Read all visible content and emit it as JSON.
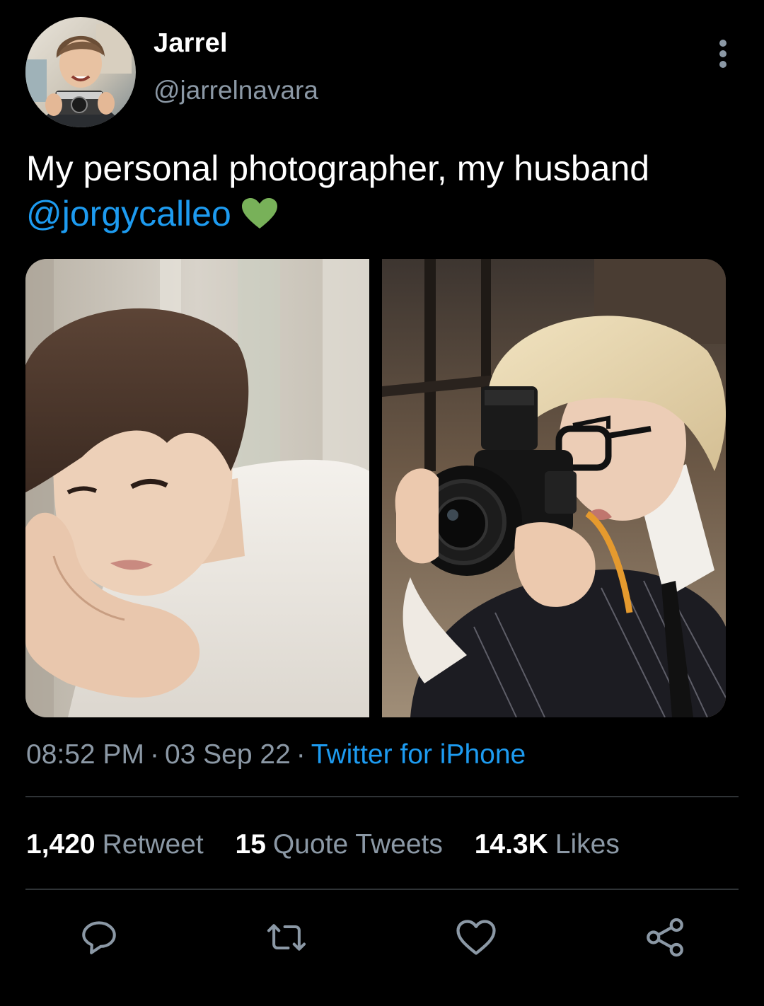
{
  "tweet": {
    "author": {
      "display_name": "Jarrel",
      "handle": "@jarrelnavara"
    },
    "text": {
      "line1": "My personal photographer, my husband",
      "mention": "@jorgycalleo",
      "emoji": "green-heart"
    },
    "media": [
      {
        "name": "photo-left"
      },
      {
        "name": "photo-right"
      }
    ],
    "timestamp": {
      "time": "08:52 PM",
      "date": "03 Sep 22",
      "separator": "·",
      "source": "Twitter for iPhone"
    },
    "stats": {
      "retweets": {
        "count": "1,420",
        "label": "Retweet"
      },
      "quotes": {
        "count": "15",
        "label": "Quote Tweets"
      },
      "likes": {
        "count": "14.3K",
        "label": "Likes"
      }
    },
    "actions": [
      {
        "icon": "reply-icon"
      },
      {
        "icon": "retweet-icon"
      },
      {
        "icon": "like-icon"
      },
      {
        "icon": "share-icon"
      }
    ]
  },
  "colors": {
    "background": "#000000",
    "primary_text": "#ffffff",
    "secondary_text": "#8b98a5",
    "link": "#1d9bf0",
    "divider": "#2f3336",
    "emoji_heart": "#78b159"
  }
}
